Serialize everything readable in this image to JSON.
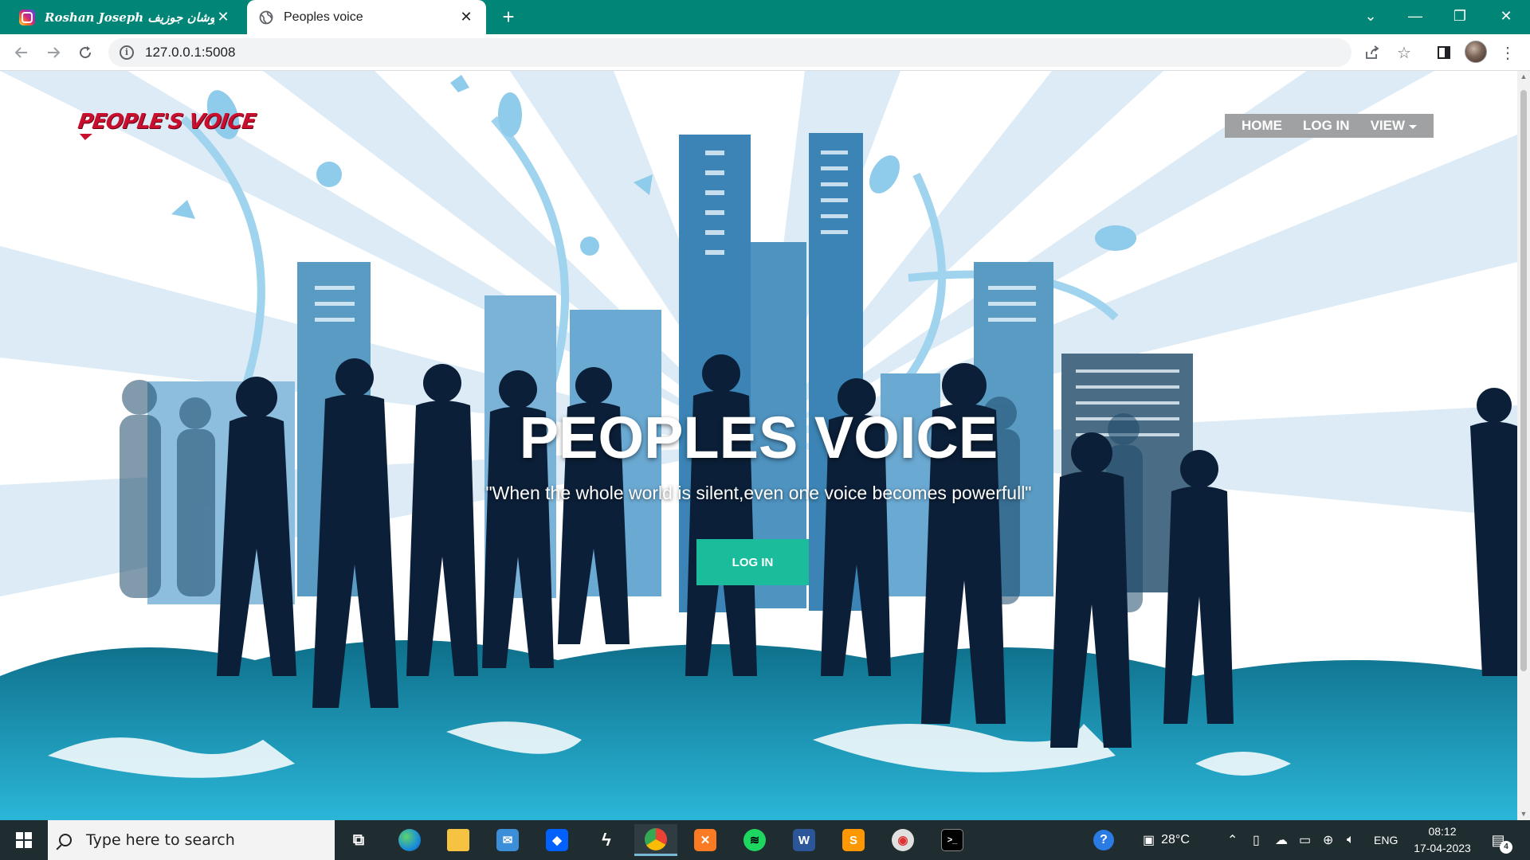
{
  "browser": {
    "tabs": [
      {
        "title": "Roshan Joseph روشان جوزيف",
        "favicon": "instagram-icon",
        "active": false
      },
      {
        "title": "Peoples voice",
        "favicon": "globe-icon",
        "active": true
      }
    ],
    "url": "127.0.0.1:5008",
    "accent_color": "#008577"
  },
  "site": {
    "logo_text": "PEOPLE'S VOICE",
    "nav": [
      {
        "label": "HOME"
      },
      {
        "label": "LOG IN"
      },
      {
        "label": "VIEW"
      }
    ],
    "hero": {
      "title": "PEOPLES VOICE",
      "tagline": "\"When the whole world is silent,even one voice becomes powerfull\"",
      "button_label": "LOG IN",
      "button_color": "#1abc9c"
    }
  },
  "taskbar": {
    "search_placeholder": "Type here to search",
    "pinned_apps": [
      "task-view-icon",
      "edge-icon",
      "file-explorer-icon",
      "mail-icon",
      "dropbox-icon",
      "app-icon",
      "chrome-icon",
      "xampp-icon",
      "spotify-icon",
      "word-icon",
      "sublime-icon",
      "media-icon",
      "terminal-icon"
    ],
    "weather": "28°C",
    "language": "ENG",
    "time": "08:12",
    "date": "17-04-2023",
    "notification_count": "4"
  }
}
